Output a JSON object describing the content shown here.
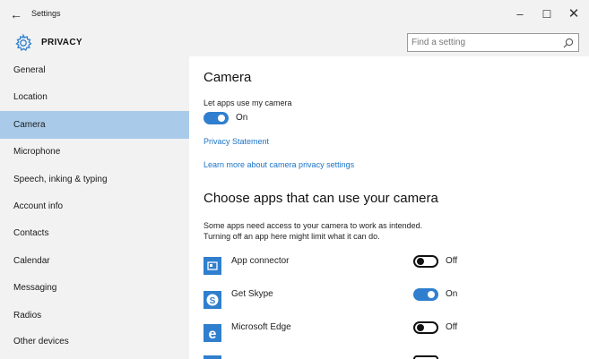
{
  "window": {
    "back_glyph": "←",
    "title": "Settings",
    "minimize_glyph": "–",
    "maximize_glyph": "☐",
    "close_glyph": "✕"
  },
  "header": {
    "section": "PRIVACY",
    "search_placeholder": "Find a setting",
    "search_value": ""
  },
  "sidebar": {
    "items": [
      {
        "label": "General"
      },
      {
        "label": "Location"
      },
      {
        "label": "Camera",
        "selected": true
      },
      {
        "label": "Microphone"
      },
      {
        "label": "Speech, inking & typing"
      },
      {
        "label": "Account info"
      },
      {
        "label": "Contacts"
      },
      {
        "label": "Calendar"
      },
      {
        "label": "Messaging"
      },
      {
        "label": "Radios"
      },
      {
        "label": "Other devices"
      }
    ]
  },
  "main": {
    "title": "Camera",
    "master_toggle_label": "Let apps use my camera",
    "master_toggle_state": "On",
    "privacy_link": "Privacy Statement",
    "learn_more_link": "Learn more about camera privacy settings",
    "choose_title": "Choose apps that can use your camera",
    "description_line1": "Some apps need access to your camera to work as intended.",
    "description_line2": "Turning off an app here might limit what it can do.",
    "apps": [
      {
        "name": "App connector",
        "state": "Off",
        "icon": "app-connector-icon"
      },
      {
        "name": "Get Skype",
        "state": "On",
        "icon": "skype-icon"
      },
      {
        "name": "Microsoft Edge",
        "state": "Off",
        "icon": "edge-icon"
      }
    ]
  },
  "colors": {
    "accent": "#2f7fce",
    "selected_nav": "#a9cbe9",
    "link": "#1b73c7",
    "chrome": "#f2f2f2"
  }
}
